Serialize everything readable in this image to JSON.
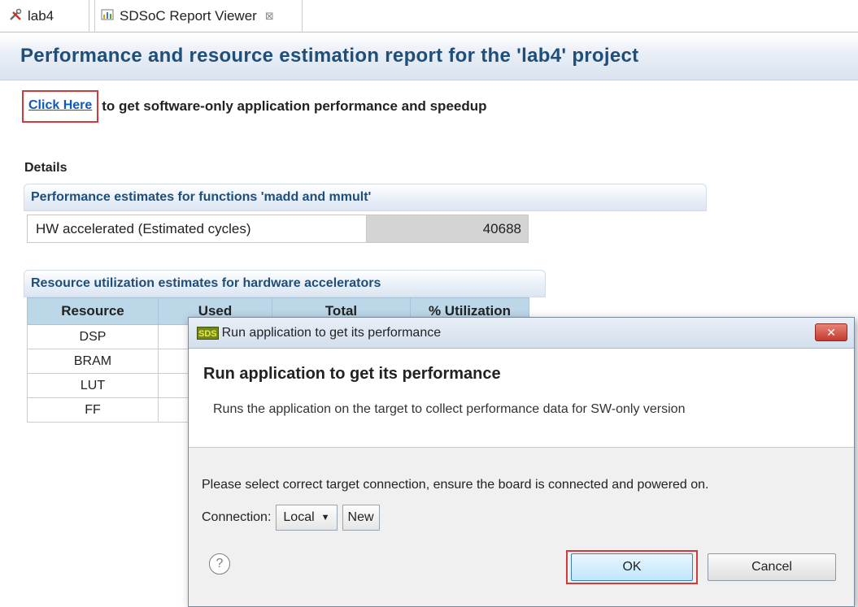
{
  "tabs": [
    {
      "label": "lab4",
      "icon": "tools-icon"
    },
    {
      "label": "SDSoC Report Viewer",
      "icon": "report-icon",
      "close": "⊠"
    }
  ],
  "header": {
    "title": "Performance and resource estimation report for the 'lab4' project"
  },
  "click_here": {
    "link_text": "Click Here",
    "rest_text": "to get software-only application performance and speedup"
  },
  "details_label": "Details",
  "performance": {
    "title": "Performance estimates for functions 'madd and mmult'",
    "row_label": "HW accelerated (Estimated cycles)",
    "row_value": "40688"
  },
  "resources": {
    "title": "Resource utilization estimates for hardware accelerators",
    "columns": [
      "Resource",
      "Used",
      "Total",
      "% Utilization"
    ],
    "rows": [
      "DSP",
      "BRAM",
      "LUT",
      "FF"
    ]
  },
  "dialog": {
    "title": "Run application to get its performance",
    "icon_text": "SDS",
    "heading": "Run application to get its performance",
    "description": "Runs the application on the target to collect performance data for SW-only version",
    "instruction": "Please select correct target connection, ensure the board is connected and powered on.",
    "connection_label": "Connection:",
    "connection_value": "Local",
    "new_label": "New",
    "ok_label": "OK",
    "cancel_label": "Cancel",
    "close_glyph": "✕"
  },
  "colors": {
    "accent": "#1f4e79",
    "link": "#0b5bbf",
    "highlight": "#d23b3b",
    "table_header": "#bcd7e8"
  }
}
